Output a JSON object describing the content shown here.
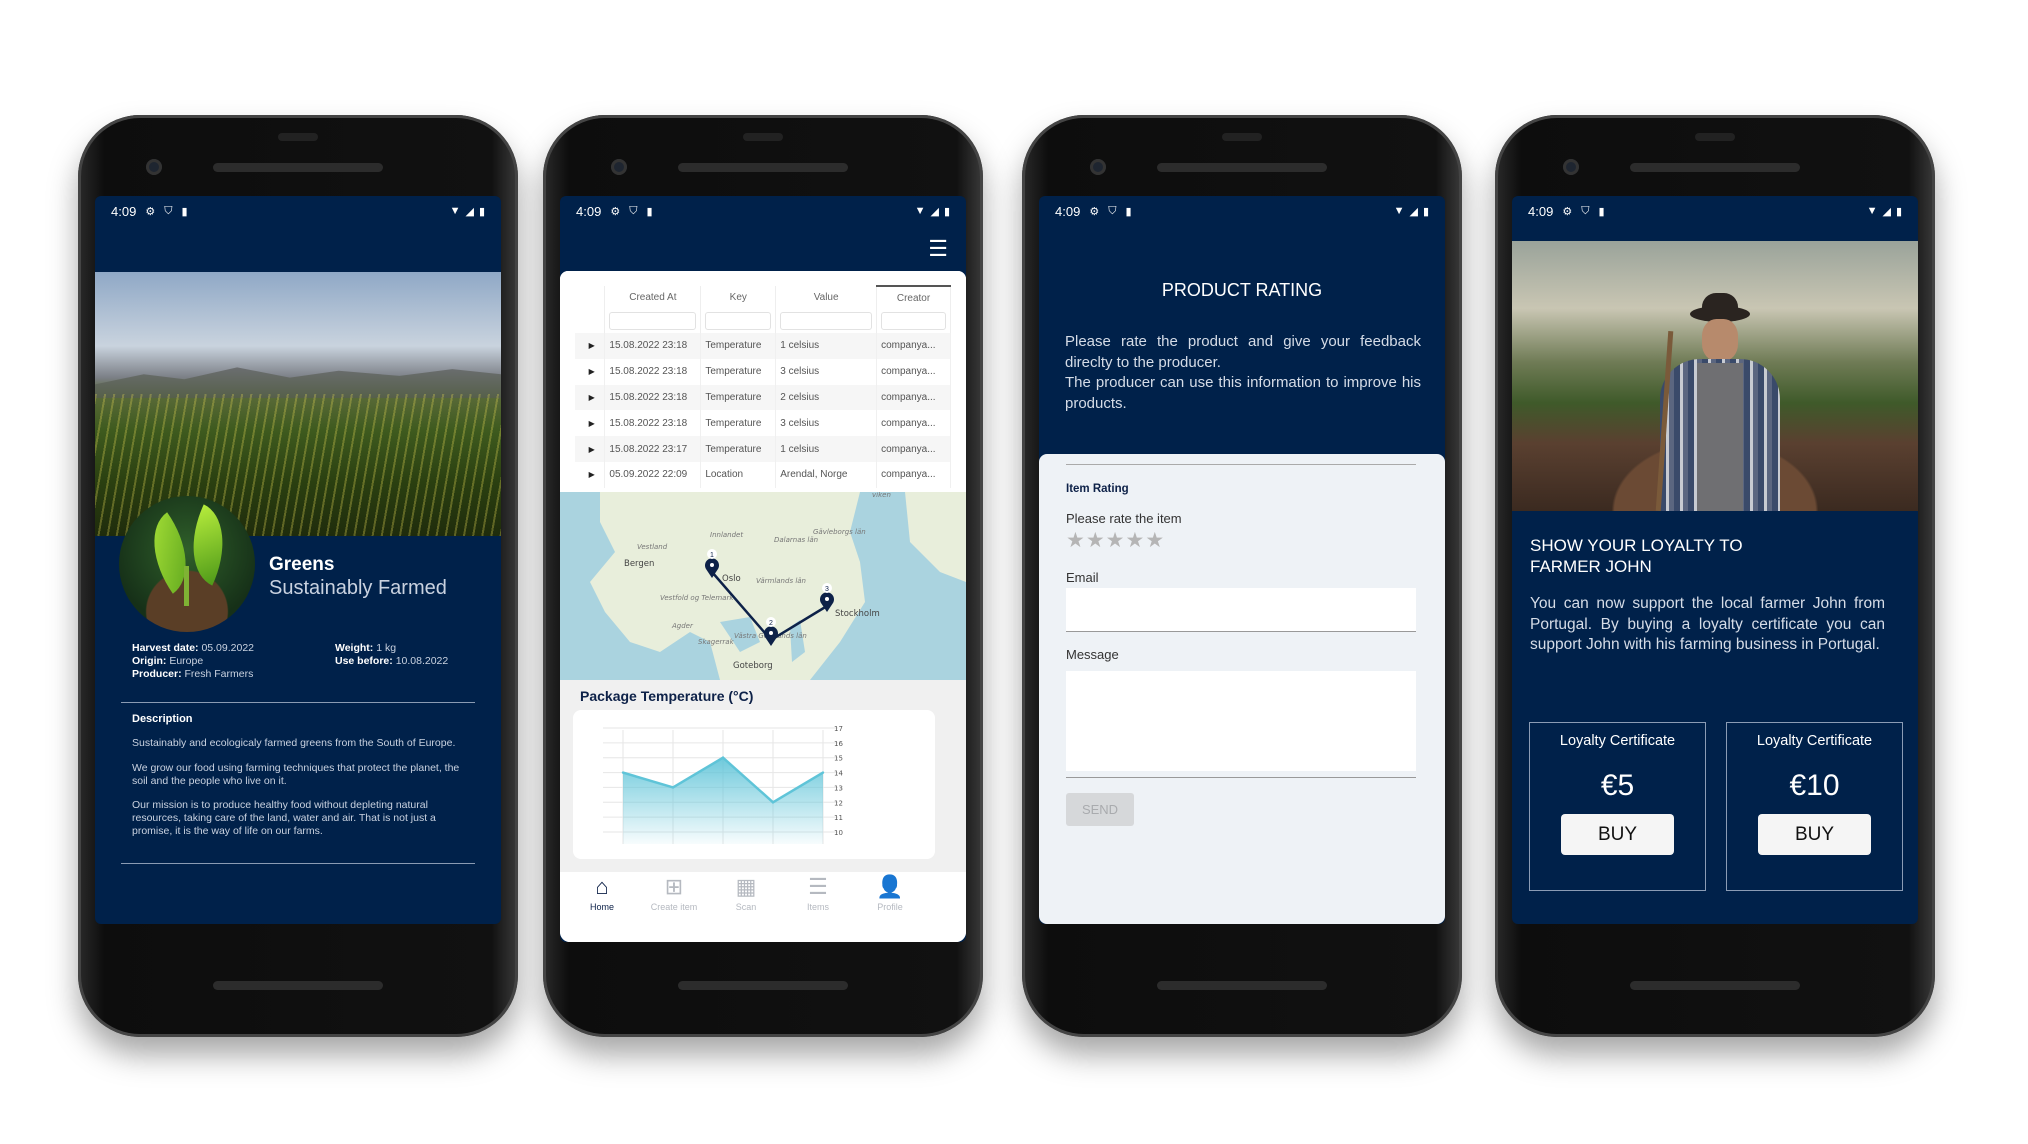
{
  "status_bar": {
    "time": "4:09",
    "left_icons": [
      "gear-icon",
      "shield-icon",
      "sd-card-icon"
    ],
    "right_icons": [
      "wifi-icon",
      "signal-icon",
      "battery-icon"
    ]
  },
  "colors": {
    "navy": "#00214a",
    "chart_fill": "#5fc4d8",
    "form_bg": "#eef2f6"
  },
  "product_screen": {
    "name": "Greens",
    "tagline": "Sustainably Farmed",
    "details_left": [
      {
        "label": "Harvest date:",
        "value": "05.09.2022"
      },
      {
        "label": "Origin:",
        "value": "Europe"
      },
      {
        "label": "Producer:",
        "value": "Fresh Farmers"
      }
    ],
    "details_right": [
      {
        "label": "Weight:",
        "value": "1 kg"
      },
      {
        "label": "Use before:",
        "value": "10.08.2022"
      }
    ],
    "description_title": "Description",
    "description": [
      "Sustainably and ecologicaly farmed greens from the South of Europe.",
      "We grow our food using farming techniques that protect the planet, the soil and the people who live on it.",
      "Our mission is to produce healthy food without depleting natural resources, taking care of the land, water and air. That is not just a promise, it is the way of life on our farms."
    ]
  },
  "tracking_screen": {
    "menu_icon": "hamburger-icon",
    "table": {
      "columns": [
        "Created At",
        "Key",
        "Value",
        "Creator"
      ],
      "rows": [
        [
          "15.08.2022 23:18",
          "Temperature",
          "1 celsius",
          "companya..."
        ],
        [
          "15.08.2022 23:18",
          "Temperature",
          "3 celsius",
          "companya..."
        ],
        [
          "15.08.2022 23:18",
          "Temperature",
          "2 celsius",
          "companya..."
        ],
        [
          "15.08.2022 23:18",
          "Temperature",
          "3 celsius",
          "companya..."
        ],
        [
          "15.08.2022 23:17",
          "Temperature",
          "1 celsius",
          "companya..."
        ],
        [
          "05.09.2022 22:09",
          "Location",
          "Arendal, Norge",
          "companya..."
        ]
      ]
    },
    "map": {
      "cities": [
        "Bergen",
        "Oslo",
        "Stockholm",
        "Goteborg"
      ],
      "regions": [
        "Innlandet",
        "Vestland",
        "Dalarnas län",
        "Gävleborgs län",
        "Värmlands län",
        "Vestfold og Telemark",
        "Agder",
        "Skagerrak",
        "Västra Götalands län",
        "viken"
      ],
      "markers": [
        "1",
        "2",
        "3"
      ]
    },
    "chart_title": "Package Temperature (°C)",
    "chart_data": {
      "type": "area",
      "title": "Package Temperature (°C)",
      "x": [
        1,
        2,
        3,
        4,
        5
      ],
      "values": [
        14,
        13,
        15,
        12,
        14
      ],
      "ylim": [
        10,
        17
      ],
      "yticks": [
        "10",
        "11",
        "12",
        "13",
        "14",
        "15",
        "16",
        "17"
      ],
      "grid": true
    },
    "nav": [
      {
        "label": "Home",
        "icon": "home-icon",
        "active": true
      },
      {
        "label": "Create item",
        "icon": "add-box-icon",
        "active": false
      },
      {
        "label": "Scan",
        "icon": "qr-scan-icon",
        "active": false
      },
      {
        "label": "Items",
        "icon": "list-icon",
        "active": false
      },
      {
        "label": "Profile",
        "icon": "person-icon",
        "active": false
      }
    ]
  },
  "rating_screen": {
    "title": "PRODUCT RATING",
    "intro": "Please rate the product and give your feedback direclty to the producer.",
    "intro2": "The producer can use this information to improve his products.",
    "section_title": "Item Rating",
    "rate_label": "Please rate the item",
    "rating": 0,
    "max_rating": 5,
    "email_label": "Email",
    "email_value": "",
    "message_label": "Message",
    "message_value": "",
    "send_label": "SEND"
  },
  "loyalty_screen": {
    "title_line1": "SHOW YOUR LOYALTY TO",
    "title_line2": "FARMER JOHN",
    "text": "You can now support the local farmer John from Portugal. By buying a loyalty certificate you can support John with his farming business in Portugal.",
    "certificates": [
      {
        "label": "Loyalty Certificate",
        "price": "€5",
        "button": "BUY"
      },
      {
        "label": "Loyalty Certificate",
        "price": "€10",
        "button": "BUY"
      }
    ]
  }
}
